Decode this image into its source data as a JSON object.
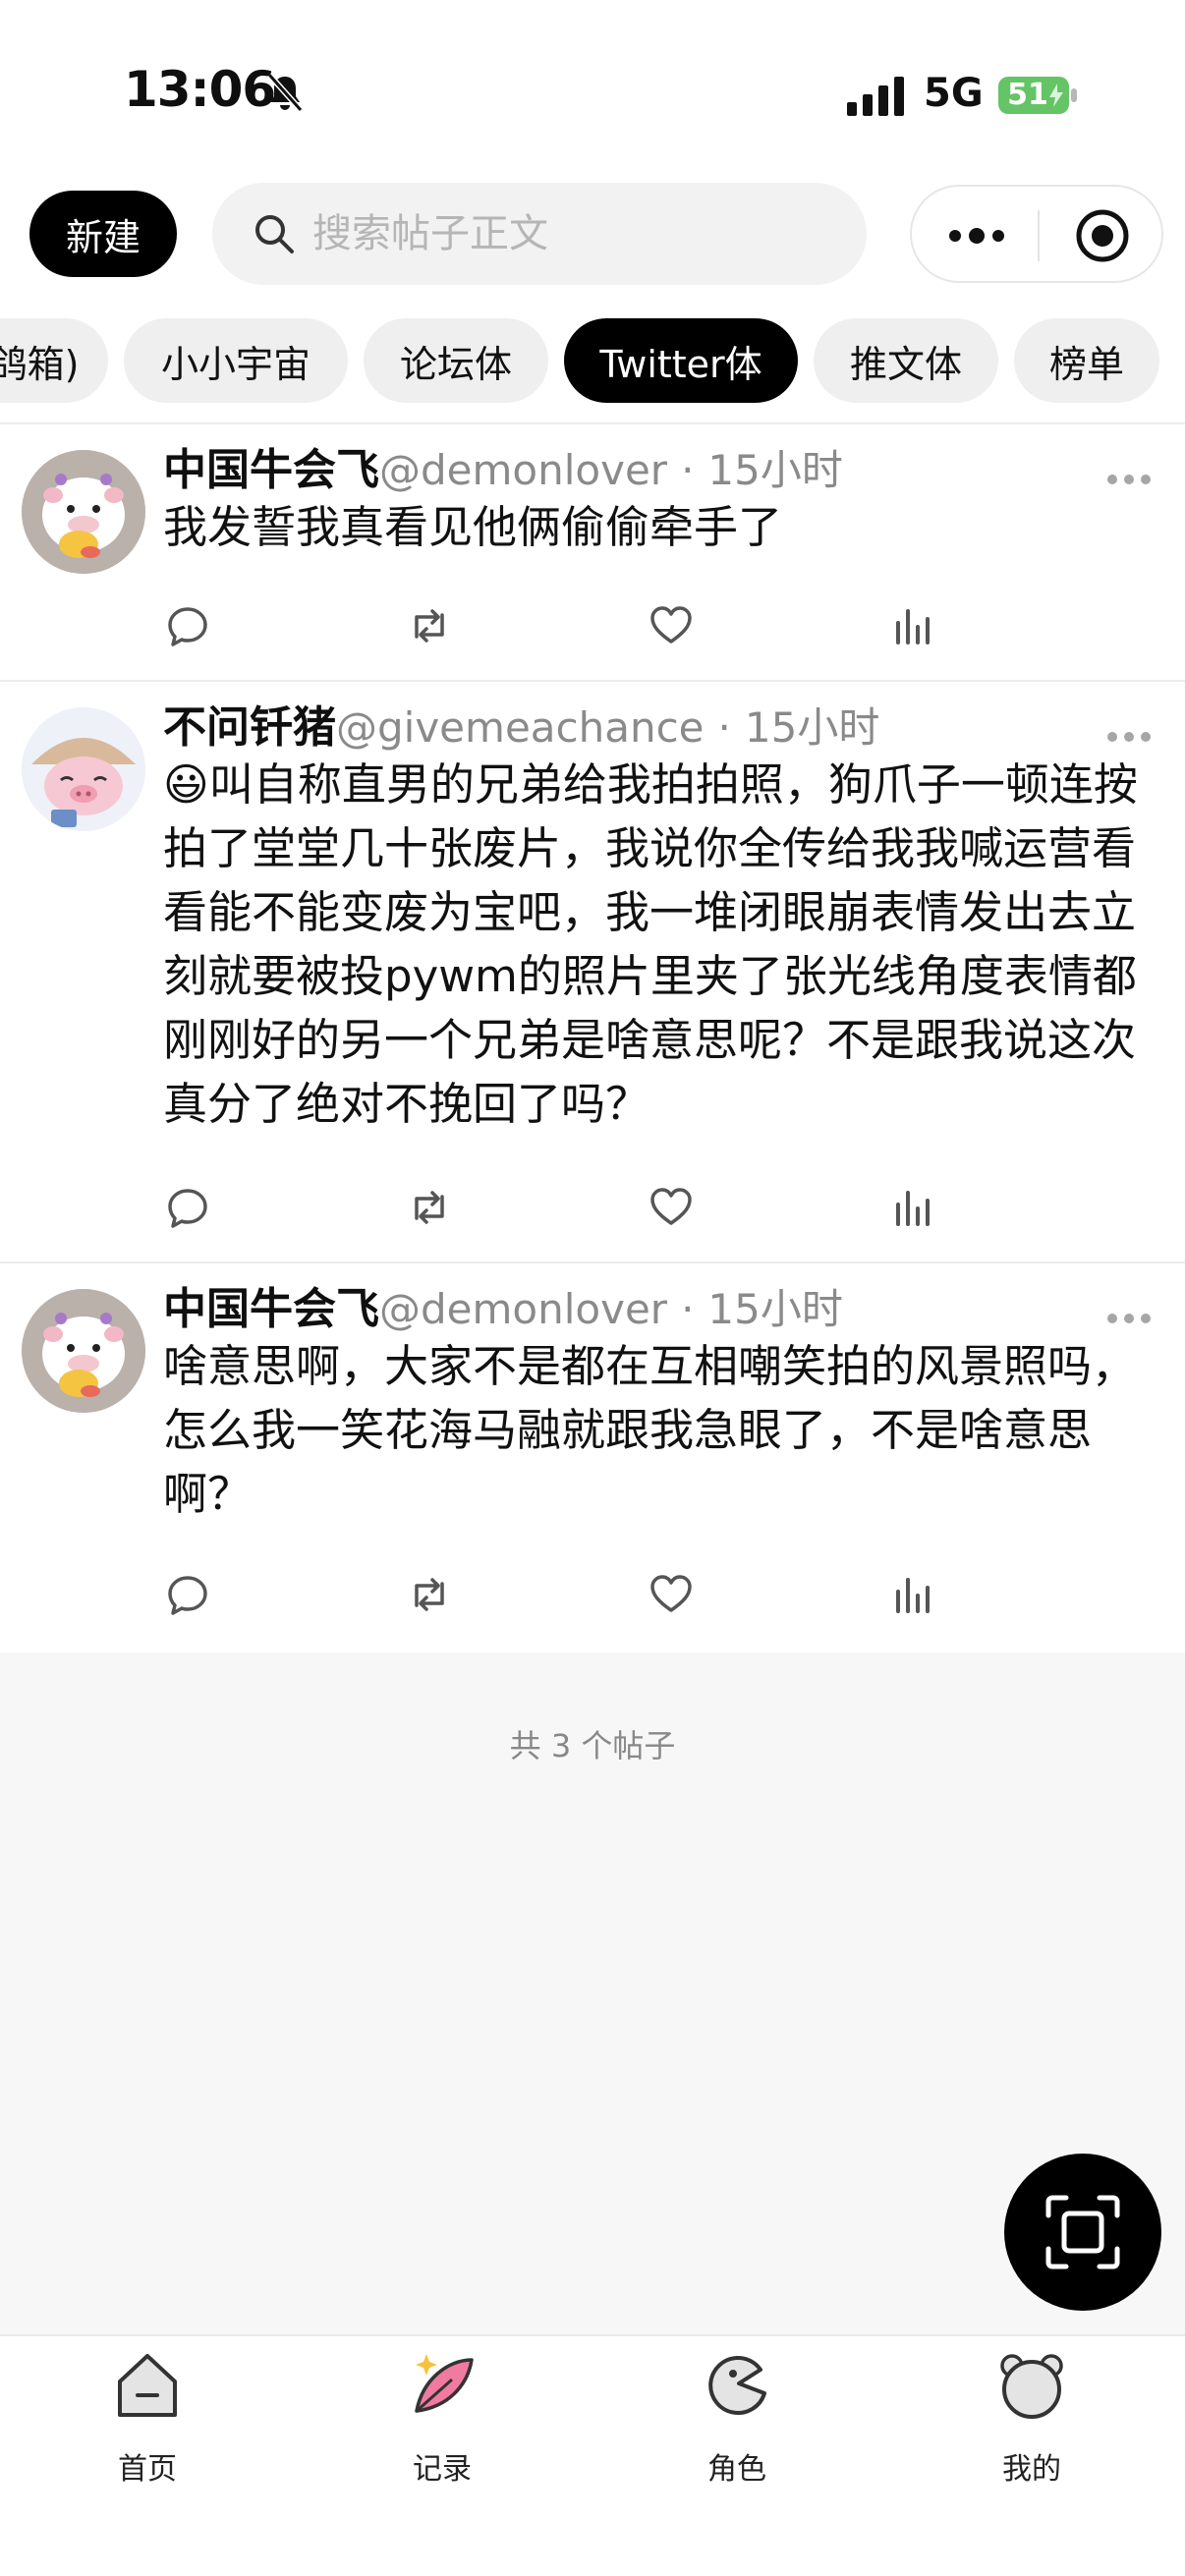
{
  "status_bar": {
    "time": "13:06",
    "network": "5G",
    "battery": "51"
  },
  "topbar": {
    "new_label": "新建",
    "search_placeholder": "搜索帖子正文"
  },
  "tabs": [
    {
      "label": "鸽箱)"
    },
    {
      "label": "小小宇宙"
    },
    {
      "label": "论坛体"
    },
    {
      "label": "Twitter体",
      "active": true
    },
    {
      "label": "推文体"
    },
    {
      "label": "榜单"
    }
  ],
  "posts": [
    {
      "author": "中国牛会飞",
      "handle": "@demonlover",
      "dot": "·",
      "time": "15小时",
      "text": "我发誓我真看见他俩偷偷牵手了"
    },
    {
      "author": "不问钎猪",
      "handle": "@givemeachance",
      "dot": "·",
      "time": "15小时",
      "emoji": "😃",
      "text": "叫自称直男的兄弟给我拍拍照，狗爪子一顿连按拍了堂堂几十张废片，我说你全传给我我喊运营看看能不能变废为宝吧，我一堆闭眼崩表情发出去立刻就要被投pywm的照片里夹了张光线角度表情都刚刚好的另一个兄弟是啥意思呢？不是跟我说这次真分了绝对不挽回了吗？"
    },
    {
      "author": "中国牛会飞",
      "handle": "@demonlover",
      "dot": "·",
      "time": "15小时",
      "text": "啥意思啊，大家不是都在互相嘲笑拍的风景照吗，怎么我一笑花海马融就跟我急眼了，不是啥意思啊？"
    }
  ],
  "footer_count": "共 3 个帖子",
  "bottom_nav": [
    {
      "label": "首页",
      "icon": "home-icon"
    },
    {
      "label": "记录",
      "icon": "record-feather-icon"
    },
    {
      "label": "角色",
      "icon": "character-icon"
    },
    {
      "label": "我的",
      "icon": "profile-bear-icon"
    }
  ],
  "colors": {
    "accent": "#000000",
    "battery_green": "#65c466",
    "muted": "#8a8a8a"
  }
}
